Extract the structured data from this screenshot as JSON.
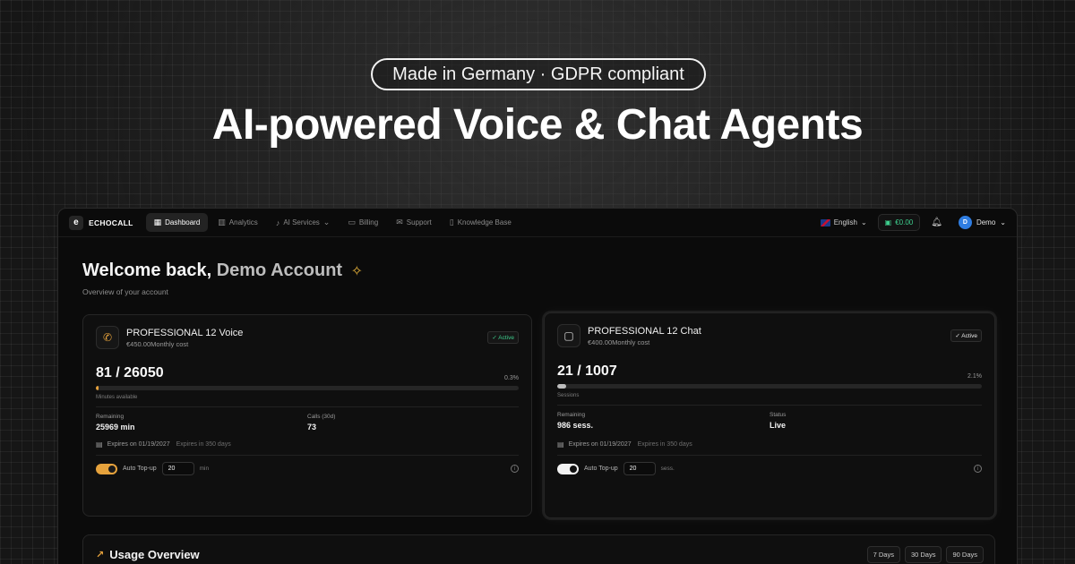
{
  "hero": {
    "badge": "Made in Germany · GDPR compliant",
    "title": "AI-powered Voice & Chat Agents"
  },
  "nav": {
    "brand": "ECHOCALL",
    "brand_logo": "e",
    "items": [
      {
        "label": "Dashboard",
        "icon": "grid-icon",
        "active": true
      },
      {
        "label": "Analytics",
        "icon": "bar-chart-icon"
      },
      {
        "label": "AI Services",
        "icon": "mic-icon"
      },
      {
        "label": "Billing",
        "icon": "card-icon"
      },
      {
        "label": "Support",
        "icon": "mail-icon"
      },
      {
        "label": "Knowledge Base",
        "icon": "book-icon"
      }
    ],
    "language": "English",
    "balance": "€0.00",
    "user_initial": "D",
    "user_name": "Demo"
  },
  "welcome": {
    "prefix": "Welcome back,",
    "name": "Demo Account",
    "subtitle": "Overview of your account"
  },
  "voice_card": {
    "plan": "PROFESSIONAL 12 Voice",
    "cost": "€450.00Monthly cost",
    "status": "✓ Active",
    "usage": "81 / 26050",
    "percent": "0.3%",
    "fill": 0.3,
    "caption": "Minutes available",
    "stat1_label": "Remaining",
    "stat1_value": "25969 min",
    "stat2_label": "Calls (30d)",
    "stat2_value": "73",
    "expires": "Expires on 01/19/2027",
    "expires_sub": "Expires in 350 days",
    "topup_label": "Auto Top-up",
    "topup_value": "20",
    "topup_unit": "min",
    "accent": "#e6a23c"
  },
  "chat_card": {
    "plan": "PROFESSIONAL 12 Chat",
    "cost": "€400.00Monthly cost",
    "status": "✓ Active",
    "usage": "21 / 1007",
    "percent": "2.1%",
    "fill": 2.1,
    "caption": "Sessions",
    "stat1_label": "Remaining",
    "stat1_value": "986 sess.",
    "stat2_label": "Status",
    "stat2_value": "Live",
    "expires": "Expires on 01/19/2027",
    "expires_sub": "Expires in 350 days",
    "topup_label": "Auto Top-up",
    "topup_value": "20",
    "topup_unit": "sess."
  },
  "usage_overview": {
    "title": "Usage Overview",
    "ranges": [
      "7 Days",
      "30 Days",
      "90 Days"
    ]
  }
}
